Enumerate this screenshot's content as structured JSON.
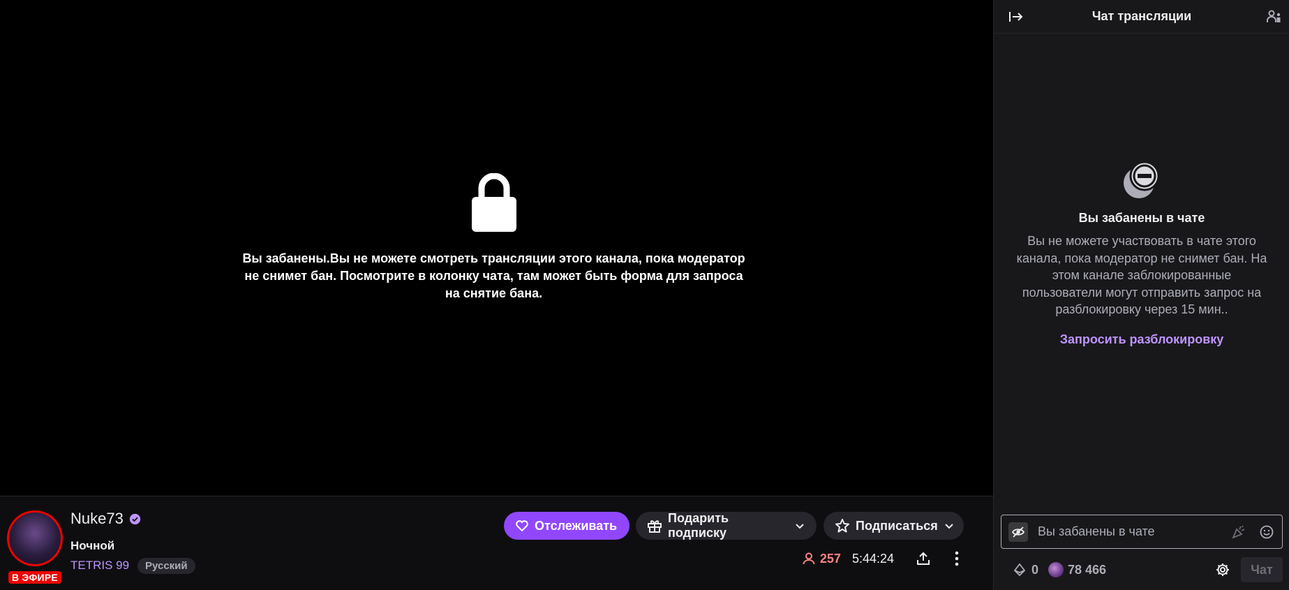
{
  "player": {
    "ban_message": "Вы забанены.Вы не можете смотреть трансляции этого канала, пока модератор не снимет бан. Посмотрите в колонку чата, там может быть форма для запроса на снятие бана."
  },
  "channel": {
    "name": "Nuke73",
    "live_badge": "В ЭФИРЕ",
    "stream_title": "Ночной",
    "category": "TETRIS 99",
    "tag": "Русский",
    "viewers": "257",
    "uptime": "5:44:24"
  },
  "actions": {
    "follow": "Отслеживать",
    "gift": "Подарить подписку",
    "subscribe": "Подписаться"
  },
  "chat": {
    "title": "Чат трансляции",
    "ban_title": "Вы забанены в чате",
    "ban_text": "Вы не можете участвовать в чате этого канала, пока модератор не снимет бан. На этом канале заблокированные пользователи могут отправить запрос на разблокировку через 15 мин..",
    "request_unban": "Запросить разблокировку",
    "input_text": "Вы забанены в чате",
    "bits": "0",
    "points": "78 466",
    "send": "Чат"
  },
  "colors": {
    "accent": "#9147ff",
    "link": "#bf94ff",
    "live": "#eb0400",
    "viewers": "#ff8280",
    "chat_bg": "#18181b"
  }
}
